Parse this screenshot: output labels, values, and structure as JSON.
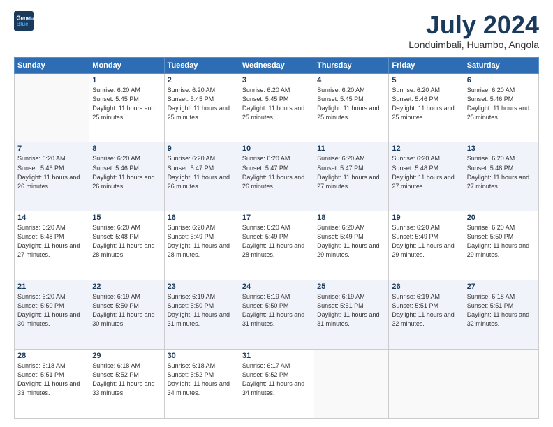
{
  "logo": {
    "line1": "General",
    "line2": "Blue"
  },
  "title": "July 2024",
  "subtitle": "Londuimbali, Huambo, Angola",
  "days": [
    "Sunday",
    "Monday",
    "Tuesday",
    "Wednesday",
    "Thursday",
    "Friday",
    "Saturday"
  ],
  "weeks": [
    [
      {
        "num": "",
        "sunrise": "",
        "sunset": "",
        "daylight": ""
      },
      {
        "num": "1",
        "sunrise": "Sunrise: 6:20 AM",
        "sunset": "Sunset: 5:45 PM",
        "daylight": "Daylight: 11 hours and 25 minutes."
      },
      {
        "num": "2",
        "sunrise": "Sunrise: 6:20 AM",
        "sunset": "Sunset: 5:45 PM",
        "daylight": "Daylight: 11 hours and 25 minutes."
      },
      {
        "num": "3",
        "sunrise": "Sunrise: 6:20 AM",
        "sunset": "Sunset: 5:45 PM",
        "daylight": "Daylight: 11 hours and 25 minutes."
      },
      {
        "num": "4",
        "sunrise": "Sunrise: 6:20 AM",
        "sunset": "Sunset: 5:45 PM",
        "daylight": "Daylight: 11 hours and 25 minutes."
      },
      {
        "num": "5",
        "sunrise": "Sunrise: 6:20 AM",
        "sunset": "Sunset: 5:46 PM",
        "daylight": "Daylight: 11 hours and 25 minutes."
      },
      {
        "num": "6",
        "sunrise": "Sunrise: 6:20 AM",
        "sunset": "Sunset: 5:46 PM",
        "daylight": "Daylight: 11 hours and 25 minutes."
      }
    ],
    [
      {
        "num": "7",
        "sunrise": "Sunrise: 6:20 AM",
        "sunset": "Sunset: 5:46 PM",
        "daylight": "Daylight: 11 hours and 26 minutes."
      },
      {
        "num": "8",
        "sunrise": "Sunrise: 6:20 AM",
        "sunset": "Sunset: 5:46 PM",
        "daylight": "Daylight: 11 hours and 26 minutes."
      },
      {
        "num": "9",
        "sunrise": "Sunrise: 6:20 AM",
        "sunset": "Sunset: 5:47 PM",
        "daylight": "Daylight: 11 hours and 26 minutes."
      },
      {
        "num": "10",
        "sunrise": "Sunrise: 6:20 AM",
        "sunset": "Sunset: 5:47 PM",
        "daylight": "Daylight: 11 hours and 26 minutes."
      },
      {
        "num": "11",
        "sunrise": "Sunrise: 6:20 AM",
        "sunset": "Sunset: 5:47 PM",
        "daylight": "Daylight: 11 hours and 27 minutes."
      },
      {
        "num": "12",
        "sunrise": "Sunrise: 6:20 AM",
        "sunset": "Sunset: 5:48 PM",
        "daylight": "Daylight: 11 hours and 27 minutes."
      },
      {
        "num": "13",
        "sunrise": "Sunrise: 6:20 AM",
        "sunset": "Sunset: 5:48 PM",
        "daylight": "Daylight: 11 hours and 27 minutes."
      }
    ],
    [
      {
        "num": "14",
        "sunrise": "Sunrise: 6:20 AM",
        "sunset": "Sunset: 5:48 PM",
        "daylight": "Daylight: 11 hours and 27 minutes."
      },
      {
        "num": "15",
        "sunrise": "Sunrise: 6:20 AM",
        "sunset": "Sunset: 5:48 PM",
        "daylight": "Daylight: 11 hours and 28 minutes."
      },
      {
        "num": "16",
        "sunrise": "Sunrise: 6:20 AM",
        "sunset": "Sunset: 5:49 PM",
        "daylight": "Daylight: 11 hours and 28 minutes."
      },
      {
        "num": "17",
        "sunrise": "Sunrise: 6:20 AM",
        "sunset": "Sunset: 5:49 PM",
        "daylight": "Daylight: 11 hours and 28 minutes."
      },
      {
        "num": "18",
        "sunrise": "Sunrise: 6:20 AM",
        "sunset": "Sunset: 5:49 PM",
        "daylight": "Daylight: 11 hours and 29 minutes."
      },
      {
        "num": "19",
        "sunrise": "Sunrise: 6:20 AM",
        "sunset": "Sunset: 5:49 PM",
        "daylight": "Daylight: 11 hours and 29 minutes."
      },
      {
        "num": "20",
        "sunrise": "Sunrise: 6:20 AM",
        "sunset": "Sunset: 5:50 PM",
        "daylight": "Daylight: 11 hours and 29 minutes."
      }
    ],
    [
      {
        "num": "21",
        "sunrise": "Sunrise: 6:20 AM",
        "sunset": "Sunset: 5:50 PM",
        "daylight": "Daylight: 11 hours and 30 minutes."
      },
      {
        "num": "22",
        "sunrise": "Sunrise: 6:19 AM",
        "sunset": "Sunset: 5:50 PM",
        "daylight": "Daylight: 11 hours and 30 minutes."
      },
      {
        "num": "23",
        "sunrise": "Sunrise: 6:19 AM",
        "sunset": "Sunset: 5:50 PM",
        "daylight": "Daylight: 11 hours and 31 minutes."
      },
      {
        "num": "24",
        "sunrise": "Sunrise: 6:19 AM",
        "sunset": "Sunset: 5:50 PM",
        "daylight": "Daylight: 11 hours and 31 minutes."
      },
      {
        "num": "25",
        "sunrise": "Sunrise: 6:19 AM",
        "sunset": "Sunset: 5:51 PM",
        "daylight": "Daylight: 11 hours and 31 minutes."
      },
      {
        "num": "26",
        "sunrise": "Sunrise: 6:19 AM",
        "sunset": "Sunset: 5:51 PM",
        "daylight": "Daylight: 11 hours and 32 minutes."
      },
      {
        "num": "27",
        "sunrise": "Sunrise: 6:18 AM",
        "sunset": "Sunset: 5:51 PM",
        "daylight": "Daylight: 11 hours and 32 minutes."
      }
    ],
    [
      {
        "num": "28",
        "sunrise": "Sunrise: 6:18 AM",
        "sunset": "Sunset: 5:51 PM",
        "daylight": "Daylight: 11 hours and 33 minutes."
      },
      {
        "num": "29",
        "sunrise": "Sunrise: 6:18 AM",
        "sunset": "Sunset: 5:52 PM",
        "daylight": "Daylight: 11 hours and 33 minutes."
      },
      {
        "num": "30",
        "sunrise": "Sunrise: 6:18 AM",
        "sunset": "Sunset: 5:52 PM",
        "daylight": "Daylight: 11 hours and 34 minutes."
      },
      {
        "num": "31",
        "sunrise": "Sunrise: 6:17 AM",
        "sunset": "Sunset: 5:52 PM",
        "daylight": "Daylight: 11 hours and 34 minutes."
      },
      {
        "num": "",
        "sunrise": "",
        "sunset": "",
        "daylight": ""
      },
      {
        "num": "",
        "sunrise": "",
        "sunset": "",
        "daylight": ""
      },
      {
        "num": "",
        "sunrise": "",
        "sunset": "",
        "daylight": ""
      }
    ]
  ]
}
